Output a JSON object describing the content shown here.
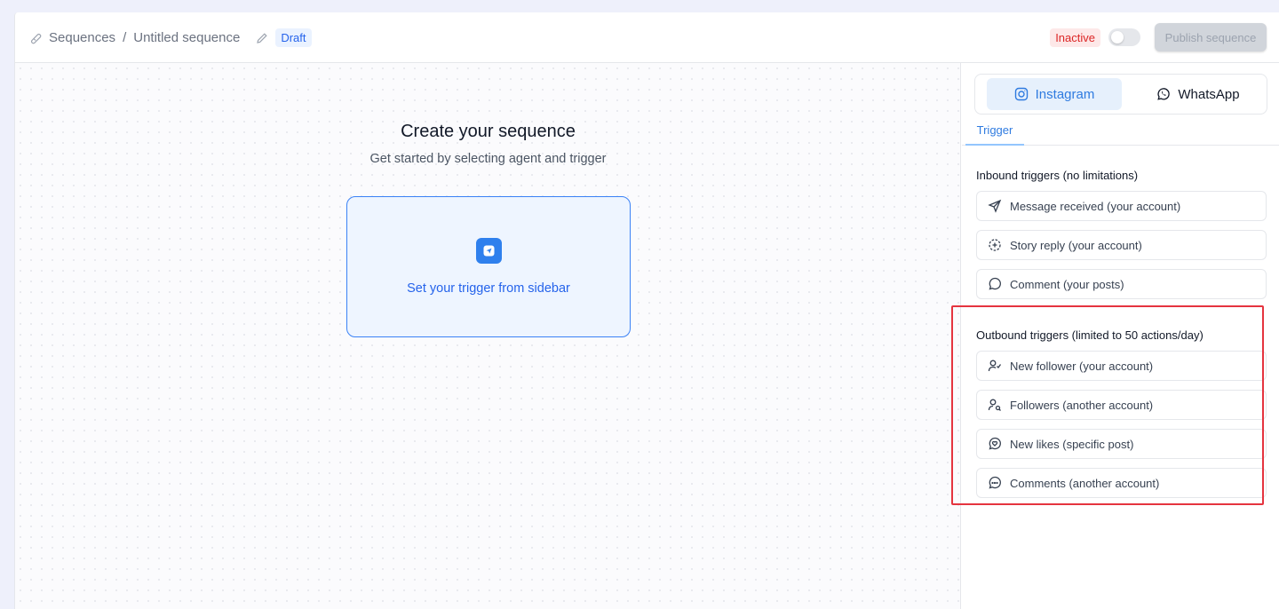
{
  "header": {
    "breadcrumb_root": "Sequences",
    "breadcrumb_separator": "/",
    "breadcrumb_current": "Untitled sequence",
    "draft_badge": "Draft",
    "status_badge": "Inactive",
    "publish_button": "Publish sequence",
    "toggle_on": false
  },
  "canvas": {
    "title": "Create your sequence",
    "subtitle": "Get started by selecting agent and trigger",
    "trigger_box_label": "Set your trigger from sidebar"
  },
  "sidebar": {
    "channels": [
      {
        "label": "Instagram",
        "icon": "instagram-icon",
        "active": true
      },
      {
        "label": "WhatsApp",
        "icon": "whatsapp-icon",
        "active": false
      }
    ],
    "tabs": [
      {
        "label": "Trigger",
        "active": true
      }
    ],
    "inbound_title": "Inbound triggers (no limitations)",
    "inbound": [
      {
        "label": "Message received (your account)",
        "icon": "send-icon"
      },
      {
        "label": "Story reply (your account)",
        "icon": "story-icon"
      },
      {
        "label": "Comment (your posts)",
        "icon": "comment-icon"
      }
    ],
    "outbound_title": "Outbound triggers (limited to 50 actions/day)",
    "outbound": [
      {
        "label": "New follower (your account)",
        "icon": "user-check-icon"
      },
      {
        "label": "Followers (another account)",
        "icon": "user-search-icon"
      },
      {
        "label": "New likes (specific post)",
        "icon": "heart-message-icon"
      },
      {
        "label": "Comments (another account)",
        "icon": "comment-dots-icon"
      }
    ]
  },
  "colors": {
    "accent": "#2f7be0",
    "highlight": "#e5343f",
    "inactive": "#dc2626"
  }
}
